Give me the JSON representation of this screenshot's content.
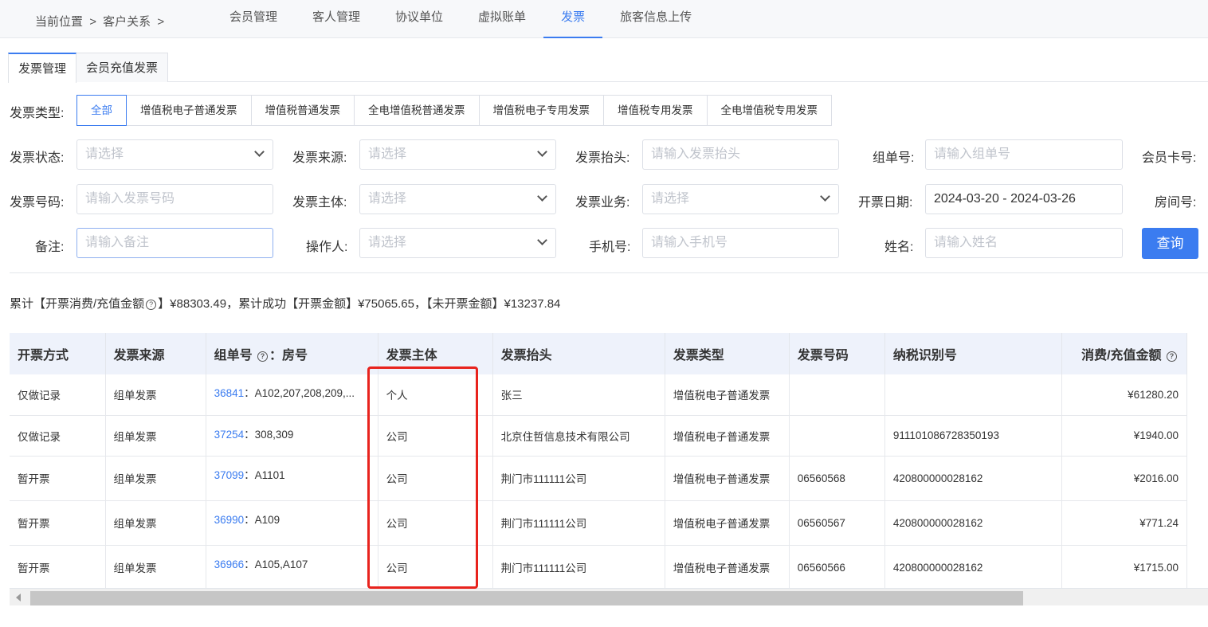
{
  "breadcrumb": {
    "prefix": "当前位置",
    "sep1": ">",
    "item": "客户关系",
    "sep2": ">"
  },
  "nav_tabs": [
    "会员管理",
    "客人管理",
    "协议单位",
    "虚拟账单",
    "发票",
    "旅客信息上传"
  ],
  "sub_tabs": [
    "发票管理",
    "会员充值发票"
  ],
  "invoice_type": {
    "label": "发票类型:",
    "options": [
      "全部",
      "增值税电子普通发票",
      "增值税普通发票",
      "全电增值税普通发票",
      "增值税电子专用发票",
      "增值税专用发票",
      "全电增值税专用发票"
    ]
  },
  "filters": {
    "status_label": "发票状态:",
    "status_placeholder": "请选择",
    "source_label": "发票来源:",
    "source_placeholder": "请选择",
    "header_label": "发票抬头:",
    "header_placeholder": "请输入发票抬头",
    "group_label": "组单号:",
    "group_placeholder": "请输入组单号",
    "card_label": "会员卡号:",
    "number_label": "发票号码:",
    "number_placeholder": "请输入发票号码",
    "entity_label": "发票主体:",
    "entity_placeholder": "请选择",
    "business_label": "发票业务:",
    "business_placeholder": "请选择",
    "date_label": "开票日期:",
    "date_value": "2024-03-20 - 2024-03-26",
    "room_label": "房间号:",
    "remark_label": "备注:",
    "remark_placeholder": "请输入备注",
    "operator_label": "操作人:",
    "operator_placeholder": "请选择",
    "phone_label": "手机号:",
    "phone_placeholder": "请输入手机号",
    "name_label": "姓名:",
    "name_placeholder": "请输入姓名",
    "query_button": "查询"
  },
  "summary": {
    "part1": "累计【开票消费/充值金额",
    "part2": "】¥88303.49，累计成功【开票金额】¥75065.65，【未开票金额】¥13237.84"
  },
  "table": {
    "headers": [
      "开票方式",
      "发票来源",
      "组单号",
      "：房号",
      "发票主体",
      "发票抬头",
      "发票类型",
      "发票号码",
      "纳税识别号",
      "消费/充值金额"
    ],
    "rows": [
      {
        "method": "仅做记录",
        "source": "组单发票",
        "group": "36841",
        "rooms": "：A102,207,208,209,...",
        "entity": "个人",
        "title": "张三",
        "type": "增值税电子普通发票",
        "number": "",
        "tax_id": "",
        "amount": "¥61280.20"
      },
      {
        "method": "仅做记录",
        "source": "组单发票",
        "group": "37254",
        "rooms": "：308,309",
        "entity": "公司",
        "title": "北京住哲信息技术有限公司",
        "type": "增值税电子普通发票",
        "number": "",
        "tax_id": "911101086728350193",
        "amount": "¥1940.00"
      },
      {
        "method": "暂开票",
        "source": "组单发票",
        "group": "37099",
        "rooms": "：A1101",
        "entity": "公司",
        "title": "荆门市111111公司",
        "type": "增值税电子普通发票",
        "number": "06560568",
        "tax_id": "420800000028162",
        "amount": "¥2016.00"
      },
      {
        "method": "暂开票",
        "source": "组单发票",
        "group": "36990",
        "rooms": "：A109",
        "entity": "公司",
        "title": "荆门市111111公司",
        "type": "增值税电子普通发票",
        "number": "06560567",
        "tax_id": "420800000028162",
        "amount": "¥771.24"
      },
      {
        "method": "暂开票",
        "source": "组单发票",
        "group": "36966",
        "rooms": "：A105,A107",
        "entity": "公司",
        "title": "荆门市111111公司",
        "type": "增值税电子普通发票",
        "number": "06560566",
        "tax_id": "420800000028162",
        "amount": "¥1715.00"
      }
    ]
  },
  "colors": {
    "accent": "#3b7cf0",
    "highlight_box": "#e8231d",
    "header_bg": "#eef2fb"
  },
  "icons": {
    "help": "question-circle-icon",
    "dropdown": "chevron-down-icon"
  }
}
